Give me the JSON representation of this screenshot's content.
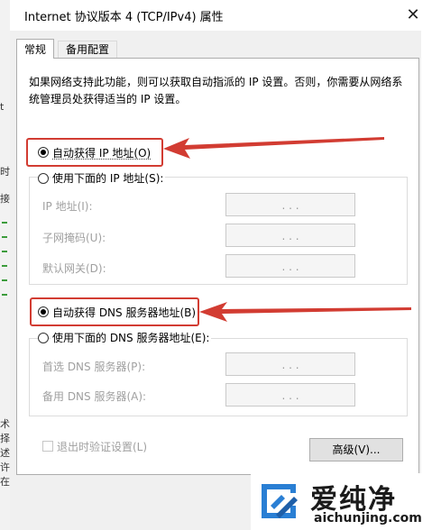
{
  "window": {
    "title": "Internet 协议版本 4 (TCP/IPv4) 属性",
    "close_glyph": "✕"
  },
  "background_window": {
    "chars": [
      "t",
      "时",
      "接",
      "术",
      "择",
      "述",
      "许",
      "在"
    ]
  },
  "tabs": [
    {
      "label": "常规",
      "active": true
    },
    {
      "label": "备用配置",
      "active": false
    }
  ],
  "description": "如果网络支持此功能，则可以获取自动指派的 IP 设置。否则，你需要从网络系统管理员处获得适当的 IP 设置。",
  "ip_section": {
    "auto_label": "自动获得 IP 地址(O)",
    "auto_selected": true,
    "manual_label": "使用下面的 IP 地址(S):",
    "manual_selected": false,
    "fields": [
      {
        "label": "IP 地址(I):",
        "value": ". . ."
      },
      {
        "label": "子网掩码(U):",
        "value": ". . ."
      },
      {
        "label": "默认网关(D):",
        "value": ". . ."
      }
    ]
  },
  "dns_section": {
    "auto_label": "自动获得 DNS 服务器地址(B)",
    "auto_selected": true,
    "manual_label": "使用下面的 DNS 服务器地址(E):",
    "manual_selected": false,
    "fields": [
      {
        "label": "首选 DNS 服务器(P):",
        "value": ". . ."
      },
      {
        "label": "备用 DNS 服务器(A):",
        "value": ". . ."
      }
    ]
  },
  "footer": {
    "validate_label": "退出时验证设置(L)",
    "validate_checked": false,
    "advanced_button": "高级(V)..."
  },
  "watermark": {
    "name": "爱纯净",
    "url": "aichunjing.com"
  },
  "colors": {
    "annotation_red": "#d23c32",
    "dialog_bg": "#f0f0f0",
    "logo_blue": "#2a7fd4"
  }
}
